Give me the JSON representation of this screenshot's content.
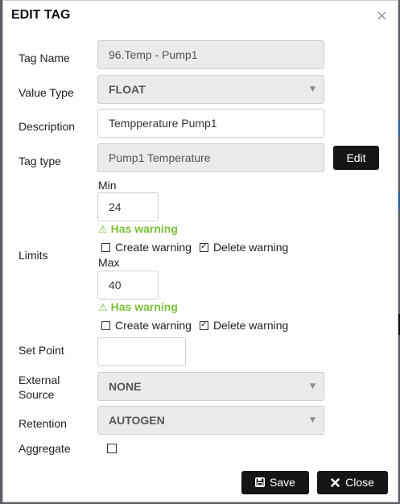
{
  "dialog": {
    "title": "EDIT TAG",
    "close_glyph": "×"
  },
  "form": {
    "tag_name": {
      "label": "Tag Name",
      "value": "96.Temp - Pump1"
    },
    "value_type": {
      "label": "Value Type",
      "value": "FLOAT"
    },
    "description": {
      "label": "Description",
      "value": "Tempperature Pump1"
    },
    "tag_type": {
      "label": "Tag type",
      "value": "Pump1 Temperature",
      "edit_label": "Edit"
    },
    "limits": {
      "label": "Limits",
      "min": {
        "label": "Min",
        "value": "24",
        "warning": "Has warning",
        "create_warning": {
          "label": "Create warning",
          "checked": false
        },
        "delete_warning": {
          "label": "Delete warning",
          "checked": true
        }
      },
      "max": {
        "label": "Max",
        "value": "40",
        "warning": "Has warning",
        "create_warning": {
          "label": "Create warning",
          "checked": false
        },
        "delete_warning": {
          "label": "Delete warning",
          "checked": true
        }
      }
    },
    "set_point": {
      "label": "Set Point",
      "value": ""
    },
    "external_source": {
      "label_line1": "External",
      "label_line2": "Source",
      "value": "NONE"
    },
    "retention": {
      "label": "Retention",
      "value": "AUTOGEN"
    },
    "aggregate": {
      "label": "Aggregate",
      "checked": false
    }
  },
  "footer": {
    "save_label": "Save",
    "close_label": "Close"
  },
  "icons": {
    "dropdown_arrow": "▼",
    "warning": "⚠",
    "save": "floppy-disk-icon",
    "close": "x-icon"
  },
  "colors": {
    "button_dark": "#151515",
    "warning_green": "#7dc03a",
    "readonly_bg": "#ebebeb"
  }
}
